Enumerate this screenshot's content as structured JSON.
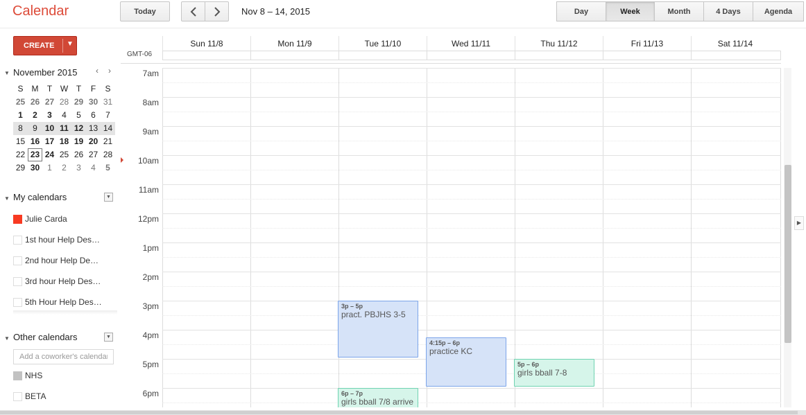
{
  "app": {
    "title": "Calendar"
  },
  "toolbar": {
    "today_label": "Today",
    "prev_icon": "chevron-left-icon",
    "next_icon": "chevron-right-icon",
    "date_range": "Nov 8 – 14, 2015",
    "views": [
      {
        "label": "Day",
        "active": false
      },
      {
        "label": "Week",
        "active": true
      },
      {
        "label": "Month",
        "active": false
      },
      {
        "label": "4 Days",
        "active": false
      },
      {
        "label": "Agenda",
        "active": false
      }
    ]
  },
  "sidebar": {
    "create_label": "CREATE",
    "mini_calendar": {
      "title": "November 2015",
      "weekday_headers": [
        "S",
        "M",
        "T",
        "W",
        "T",
        "F",
        "S"
      ],
      "weeks": [
        [
          "25",
          "26",
          "27",
          "28",
          "29",
          "30",
          "31"
        ],
        [
          "1",
          "2",
          "3",
          "4",
          "5",
          "6",
          "7"
        ],
        [
          "8",
          "9",
          "10",
          "11",
          "12",
          "13",
          "14"
        ],
        [
          "15",
          "16",
          "17",
          "18",
          "19",
          "20",
          "21"
        ],
        [
          "22",
          "23",
          "24",
          "25",
          "26",
          "27",
          "28"
        ],
        [
          "29",
          "30",
          "1",
          "2",
          "3",
          "4",
          "5"
        ]
      ],
      "today": "23",
      "highlighted_week_index": 2
    },
    "my_calendars": {
      "title": "My calendars",
      "items": [
        {
          "label": "Julie Carda",
          "color": "#f83a22",
          "checked": true
        },
        {
          "label": "1st hour Help Des…",
          "checked": false
        },
        {
          "label": "2nd hour Help De…",
          "checked": false
        },
        {
          "label": "3rd hour Help Des…",
          "checked": false
        },
        {
          "label": "5th Hour Help Des…",
          "checked": false
        }
      ]
    },
    "other_calendars": {
      "title": "Other calendars",
      "add_placeholder": "Add a coworker's calendar",
      "items": [
        {
          "label": "NHS",
          "color": "#c2c2c2",
          "checked": true
        },
        {
          "label": "BETA",
          "checked": false
        }
      ]
    }
  },
  "week_view": {
    "timezone": "GMT-06",
    "days": [
      "Sun 11/8",
      "Mon 11/9",
      "Tue 11/10",
      "Wed 11/11",
      "Thu 11/12",
      "Fri 11/13",
      "Sat 11/14"
    ],
    "hours": [
      "7am",
      "8am",
      "9am",
      "10am",
      "11am",
      "12pm",
      "1pm",
      "2pm",
      "3pm",
      "4pm",
      "5pm",
      "6pm"
    ],
    "events": [
      {
        "time": "3p – 5p",
        "title": "pract. PBJHS 3-5",
        "day": "Tue 11/10",
        "color": "#d6e3f8"
      },
      {
        "time": "4:15p – 6p",
        "title": "practice KC",
        "day": "Wed 11/11",
        "color": "#d6e3f8"
      },
      {
        "time": "5p – 6p",
        "title": "girls bball 7-8",
        "day": "Thu 11/12",
        "color": "#d6f5ea"
      },
      {
        "time": "6p – 7p",
        "title": "girls bball 7/8 arrive",
        "day": "Tue 11/10",
        "color": "#d6f5ea"
      }
    ]
  }
}
